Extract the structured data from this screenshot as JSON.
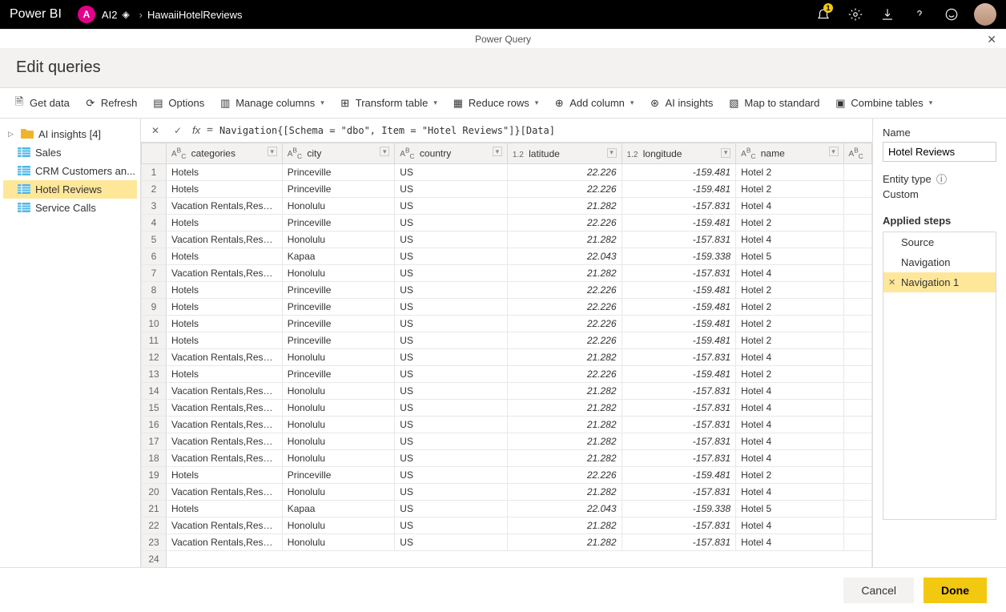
{
  "topbar": {
    "app_name": "Power BI",
    "workspace_badge": "A",
    "workspace_name": "AI2",
    "breadcrumb_item": "HawaiiHotelReviews",
    "notif_badge": "1"
  },
  "pq_title": "Power Query",
  "header_title": "Edit queries",
  "toolbar": {
    "get_data": "Get data",
    "refresh": "Refresh",
    "options": "Options",
    "manage_columns": "Manage columns",
    "transform_table": "Transform table",
    "reduce_rows": "Reduce rows",
    "add_column": "Add column",
    "ai_insights": "AI insights",
    "map_to_standard": "Map to standard",
    "combine_tables": "Combine tables"
  },
  "queries": {
    "folder_label": "AI insights [4]",
    "items": [
      {
        "label": "Sales"
      },
      {
        "label": "CRM Customers an..."
      },
      {
        "label": "Hotel Reviews",
        "selected": true
      },
      {
        "label": "Service Calls"
      }
    ]
  },
  "formula": {
    "eq": "=",
    "text": "Navigation{[Schema = \"dbo\", Item = \"Hotel Reviews\"]}[Data]"
  },
  "grid": {
    "columns": [
      {
        "type": "ABC",
        "label": "categories",
        "cls": "col-cat"
      },
      {
        "type": "ABC",
        "label": "city",
        "cls": "col-city"
      },
      {
        "type": "ABC",
        "label": "country",
        "cls": "col-country"
      },
      {
        "type": "1.2",
        "label": "latitude",
        "cls": "col-lat",
        "numeric": true
      },
      {
        "type": "1.2",
        "label": "longitude",
        "cls": "col-lon",
        "numeric": true
      },
      {
        "type": "ABC",
        "label": "name",
        "cls": "col-name"
      }
    ],
    "rows": [
      [
        "Hotels",
        "Princeville",
        "US",
        "22.226",
        "-159.481",
        "Hotel 2"
      ],
      [
        "Hotels",
        "Princeville",
        "US",
        "22.226",
        "-159.481",
        "Hotel 2"
      ],
      [
        "Vacation Rentals,Resorts &...",
        "Honolulu",
        "US",
        "21.282",
        "-157.831",
        "Hotel 4"
      ],
      [
        "Hotels",
        "Princeville",
        "US",
        "22.226",
        "-159.481",
        "Hotel 2"
      ],
      [
        "Vacation Rentals,Resorts &...",
        "Honolulu",
        "US",
        "21.282",
        "-157.831",
        "Hotel 4"
      ],
      [
        "Hotels",
        "Kapaa",
        "US",
        "22.043",
        "-159.338",
        "Hotel 5"
      ],
      [
        "Vacation Rentals,Resorts &...",
        "Honolulu",
        "US",
        "21.282",
        "-157.831",
        "Hotel 4"
      ],
      [
        "Hotels",
        "Princeville",
        "US",
        "22.226",
        "-159.481",
        "Hotel 2"
      ],
      [
        "Hotels",
        "Princeville",
        "US",
        "22.226",
        "-159.481",
        "Hotel 2"
      ],
      [
        "Hotels",
        "Princeville",
        "US",
        "22.226",
        "-159.481",
        "Hotel 2"
      ],
      [
        "Hotels",
        "Princeville",
        "US",
        "22.226",
        "-159.481",
        "Hotel 2"
      ],
      [
        "Vacation Rentals,Resorts &...",
        "Honolulu",
        "US",
        "21.282",
        "-157.831",
        "Hotel 4"
      ],
      [
        "Hotels",
        "Princeville",
        "US",
        "22.226",
        "-159.481",
        "Hotel 2"
      ],
      [
        "Vacation Rentals,Resorts &...",
        "Honolulu",
        "US",
        "21.282",
        "-157.831",
        "Hotel 4"
      ],
      [
        "Vacation Rentals,Resorts &...",
        "Honolulu",
        "US",
        "21.282",
        "-157.831",
        "Hotel 4"
      ],
      [
        "Vacation Rentals,Resorts &...",
        "Honolulu",
        "US",
        "21.282",
        "-157.831",
        "Hotel 4"
      ],
      [
        "Vacation Rentals,Resorts &...",
        "Honolulu",
        "US",
        "21.282",
        "-157.831",
        "Hotel 4"
      ],
      [
        "Vacation Rentals,Resorts &...",
        "Honolulu",
        "US",
        "21.282",
        "-157.831",
        "Hotel 4"
      ],
      [
        "Hotels",
        "Princeville",
        "US",
        "22.226",
        "-159.481",
        "Hotel 2"
      ],
      [
        "Vacation Rentals,Resorts &...",
        "Honolulu",
        "US",
        "21.282",
        "-157.831",
        "Hotel 4"
      ],
      [
        "Hotels",
        "Kapaa",
        "US",
        "22.043",
        "-159.338",
        "Hotel 5"
      ],
      [
        "Vacation Rentals,Resorts &...",
        "Honolulu",
        "US",
        "21.282",
        "-157.831",
        "Hotel 4"
      ],
      [
        "Vacation Rentals,Resorts &...",
        "Honolulu",
        "US",
        "21.282",
        "-157.831",
        "Hotel 4"
      ]
    ]
  },
  "right": {
    "name_label": "Name",
    "name_value": "Hotel Reviews",
    "entity_type_label": "Entity type",
    "entity_type_value": "Custom",
    "steps_label": "Applied steps",
    "steps": [
      {
        "label": "Source"
      },
      {
        "label": "Navigation"
      },
      {
        "label": "Navigation 1",
        "selected": true,
        "deletable": true
      }
    ]
  },
  "footer": {
    "cancel": "Cancel",
    "done": "Done"
  }
}
